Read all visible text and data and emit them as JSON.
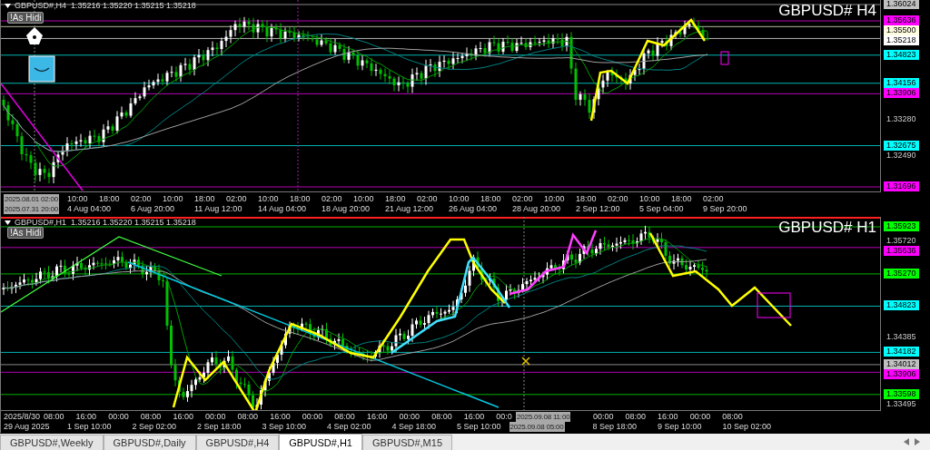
{
  "panels": [
    {
      "header": "GBPUSD#,H4  1.35216 1.35220 1.35215 1.35218",
      "button": "!As Hidi",
      "title": "GBPUSD# H4",
      "price_labels": [
        {
          "kind": "tag",
          "text": "1.36024",
          "color": "#c0c0c0"
        },
        {
          "kind": "tag",
          "text": "1.35636",
          "color": "#ff00ff"
        },
        {
          "kind": "tag",
          "text": "1.35500",
          "color": "#fffde0"
        },
        {
          "kind": "tag",
          "text": "1.35218",
          "color": "#ffffff"
        },
        {
          "kind": "tag",
          "text": "1.34823",
          "color": "#00ffff"
        },
        {
          "kind": "tag",
          "text": "1.34156",
          "color": "#00ffff"
        },
        {
          "kind": "tag",
          "text": "1.33906",
          "color": "#ff00ff"
        },
        {
          "kind": "tick",
          "text": "1.33280"
        },
        {
          "kind": "tag",
          "text": "1.32675",
          "color": "#00ffff"
        },
        {
          "kind": "tick",
          "text": "1.32490"
        },
        {
          "kind": "tag",
          "text": "1.31696",
          "color": "#ff00ff"
        }
      ],
      "axis_rows": [
        [
          {
            "kind": "cursor",
            "text": "2025.08.01 02:00"
          },
          {
            "kind": "tick",
            "text": "10:00"
          },
          {
            "kind": "tick",
            "text": "18:00"
          },
          {
            "kind": "tick",
            "text": "02:00"
          },
          {
            "kind": "tick",
            "text": "10:00"
          },
          {
            "kind": "tick",
            "text": "18:00"
          },
          {
            "kind": "tick",
            "text": "02:00"
          },
          {
            "kind": "tick",
            "text": "10:00"
          },
          {
            "kind": "tick",
            "text": "18:00"
          },
          {
            "kind": "tick",
            "text": "02:00"
          },
          {
            "kind": "tick",
            "text": "10:00"
          },
          {
            "kind": "tick",
            "text": "18:00"
          },
          {
            "kind": "tick",
            "text": "02:00"
          },
          {
            "kind": "tick",
            "text": "10:00"
          },
          {
            "kind": "tick",
            "text": "18:00"
          },
          {
            "kind": "tick",
            "text": "02:00"
          },
          {
            "kind": "tick",
            "text": "10:00"
          },
          {
            "kind": "tick",
            "text": "18:00"
          },
          {
            "kind": "tick",
            "text": "02:00"
          },
          {
            "kind": "tick",
            "text": "10:00"
          },
          {
            "kind": "tick",
            "text": "18:00"
          },
          {
            "kind": "tick",
            "text": "02:00"
          }
        ],
        [
          {
            "kind": "cursor",
            "text": "2025.07.31 20:00"
          },
          {
            "kind": "tick",
            "text": "4 Aug 04:00"
          },
          {
            "kind": "tick",
            "text": "6 Aug 20:00"
          },
          {
            "kind": "tick",
            "text": "11 Aug 12:00"
          },
          {
            "kind": "tick",
            "text": "14 Aug 04:00"
          },
          {
            "kind": "tick",
            "text": "18 Aug 20:00"
          },
          {
            "kind": "tick",
            "text": "21 Aug 12:00"
          },
          {
            "kind": "tick",
            "text": "26 Aug 04:00"
          },
          {
            "kind": "tick",
            "text": "28 Aug 20:00"
          },
          {
            "kind": "tick",
            "text": "2 Sep 12:00"
          },
          {
            "kind": "tick",
            "text": "5 Sep 04:00"
          },
          {
            "kind": "tick",
            "text": "9 Sep 20:00"
          }
        ]
      ]
    },
    {
      "header": "GBPUSD#,H1  1.35216 1.35220 1.35215 1.35218",
      "button": "!As Hidi",
      "title": "GBPUSD# H1",
      "price_labels": [
        {
          "kind": "tag",
          "text": "1.35923",
          "color": "#00ff00"
        },
        {
          "kind": "tick",
          "text": "1.35720"
        },
        {
          "kind": "tag",
          "text": "1.35636",
          "color": "#ff00ff"
        },
        {
          "kind": "tag",
          "text": "1.35270",
          "color": "#00ff00"
        },
        {
          "kind": "tag",
          "text": "1.34823",
          "color": "#00ffff"
        },
        {
          "kind": "tick",
          "text": "1.34385"
        },
        {
          "kind": "tag",
          "text": "1.34182",
          "color": "#00ffff"
        },
        {
          "kind": "tag",
          "text": "1.34012",
          "color": "#c0c0c0"
        },
        {
          "kind": "tag",
          "text": "1.33906",
          "color": "#ff00ff"
        },
        {
          "kind": "tag",
          "text": "1.33598",
          "color": "#00ff00"
        },
        {
          "kind": "tick",
          "text": "1.33495"
        }
      ],
      "axis_rows": [
        [
          {
            "kind": "start",
            "text": "2025/8/30"
          },
          {
            "kind": "tick",
            "text": "08:00"
          },
          {
            "kind": "tick",
            "text": "16:00"
          },
          {
            "kind": "tick",
            "text": "00:00"
          },
          {
            "kind": "tick",
            "text": "08:00"
          },
          {
            "kind": "tick",
            "text": "16:00"
          },
          {
            "kind": "tick",
            "text": "00:00"
          },
          {
            "kind": "tick",
            "text": "08:00"
          },
          {
            "kind": "tick",
            "text": "16:00"
          },
          {
            "kind": "tick",
            "text": "00:00"
          },
          {
            "kind": "tick",
            "text": "08:00"
          },
          {
            "kind": "tick",
            "text": "16:00"
          },
          {
            "kind": "tick",
            "text": "00:00"
          },
          {
            "kind": "tick",
            "text": "08:00"
          },
          {
            "kind": "tick",
            "text": "16:00"
          },
          {
            "kind": "tick",
            "text": "00:0"
          },
          {
            "kind": "cursor",
            "text": "2025.09.08 11:00"
          },
          {
            "kind": "tick",
            "text": "00:00"
          },
          {
            "kind": "tick",
            "text": "08:00"
          },
          {
            "kind": "tick",
            "text": "16:00"
          },
          {
            "kind": "tick",
            "text": "00:00"
          },
          {
            "kind": "tick",
            "text": "08:00"
          }
        ],
        [
          {
            "kind": "start",
            "text": "29 Aug 2025"
          },
          {
            "kind": "tick",
            "text": "1 Sep 10:00"
          },
          {
            "kind": "tick",
            "text": "2 Sep 02:00"
          },
          {
            "kind": "tick",
            "text": "2 Sep 18:00"
          },
          {
            "kind": "tick",
            "text": "3 Sep 10:00"
          },
          {
            "kind": "tick",
            "text": "4 Sep 02:00"
          },
          {
            "kind": "tick",
            "text": "4 Sep 18:00"
          },
          {
            "kind": "tick",
            "text": "5 Sep 10:00"
          },
          {
            "kind": "cursor",
            "text": "2025.09.08 05:00"
          },
          {
            "kind": "tick",
            "text": "8 Sep 18:00"
          },
          {
            "kind": "tick",
            "text": "9 Sep 10:00"
          },
          {
            "kind": "tick",
            "text": "10 Sep 02:00"
          }
        ]
      ]
    }
  ],
  "tabs": [
    {
      "label": "GBPUSD#,Weekly",
      "selected": false
    },
    {
      "label": "GBPUSD#,Daily",
      "selected": false
    },
    {
      "label": "GBPUSD#,H4",
      "selected": false
    },
    {
      "label": "GBPUSD#,H1",
      "selected": true
    },
    {
      "label": "GBPUSD#,M15",
      "selected": false
    }
  ]
}
